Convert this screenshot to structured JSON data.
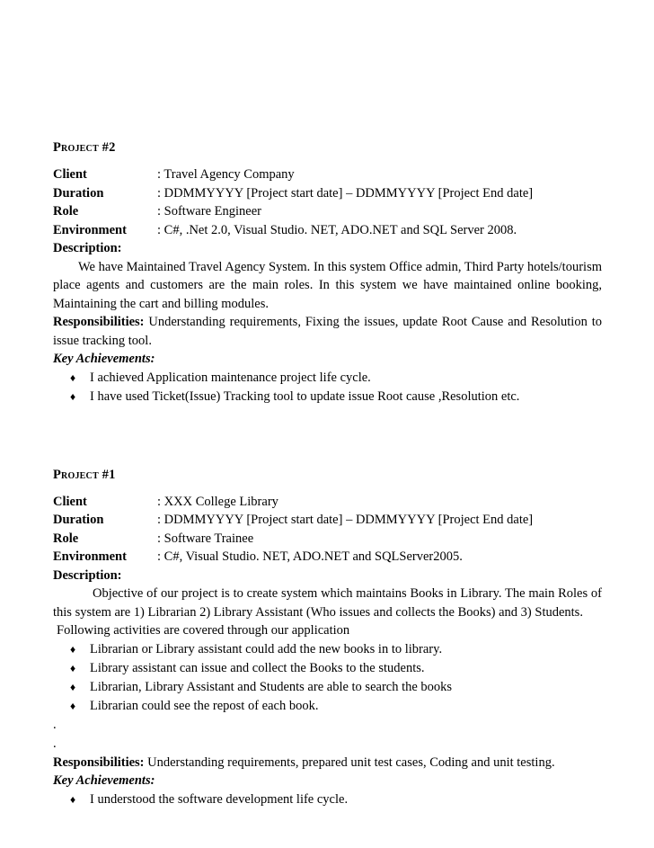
{
  "document": {
    "bullet_glyph": "♦",
    "text_color": "#000000",
    "background_color": "#ffffff"
  },
  "projects": [
    {
      "heading": "Project #2",
      "fields": [
        {
          "label": "Client",
          "value": "Travel Agency Company"
        },
        {
          "label": "Duration",
          "value": "DDMMYYYY [Project start date] – DDMMYYYY [Project End date]"
        },
        {
          "label": "Role",
          "value": "Software Engineer"
        },
        {
          "label": "Environment",
          "value": "C#, .Net 2.0, Visual Studio. NET, ADO.NET and SQL Server 2008."
        }
      ],
      "description_label": "Description:",
      "description_text": "We have Maintained Travel Agency System. In this system Office admin, Third Party hotels/tourism place agents and customers are the main roles. In this system we have maintained online booking, Maintaining the cart and billing modules.",
      "responsibilities_label": "Responsibilities:",
      "responsibilities_text": "Understanding requirements, Fixing the issues, update Root Cause and Resolution to issue tracking tool.",
      "key_achievements_label": "Key Achievements",
      "key_achievements_colon": ":",
      "key_achievements": [
        "I achieved Application maintenance project life cycle.",
        "I have used Ticket(Issue) Tracking tool to update issue Root cause ,Resolution etc."
      ]
    },
    {
      "heading": "Project #1",
      "fields": [
        {
          "label": "Client",
          "value": "XXX College Library"
        },
        {
          "label": "Duration",
          "value": "DDMMYYYY [Project start date] – DDMMYYYY [Project End date]"
        },
        {
          "label": "Role",
          "value": "Software Trainee"
        },
        {
          "label": "Environment",
          "value": "C#,  Visual Studio. NET, ADO.NET and SQLServer2005."
        }
      ],
      "description_label": "Description:",
      "description_text": "Objective of our project is to create system which maintains Books in Library. The main Roles of this system are 1) Librarian 2) Library Assistant (Who issues and collects the Books) and 3) Students.",
      "activities_intro": "Following activities are covered through our application",
      "activities": [
        "Librarian or Library assistant could add the new books in to library.",
        "Library assistant can issue and collect the Books to the students.",
        "Librarian, Library Assistant and Students are able to search the books",
        "Librarian could see the repost of each book."
      ],
      "trailing_dots": [
        ".",
        "."
      ],
      "responsibilities_label": "Responsibilities:",
      "responsibilities_text": "Understanding requirements, prepared unit test cases, Coding and unit testing.",
      "key_achievements_label": "Key Achievements",
      "key_achievements_colon": ":",
      "key_achievements": [
        "I understood the software development life cycle."
      ]
    }
  ]
}
